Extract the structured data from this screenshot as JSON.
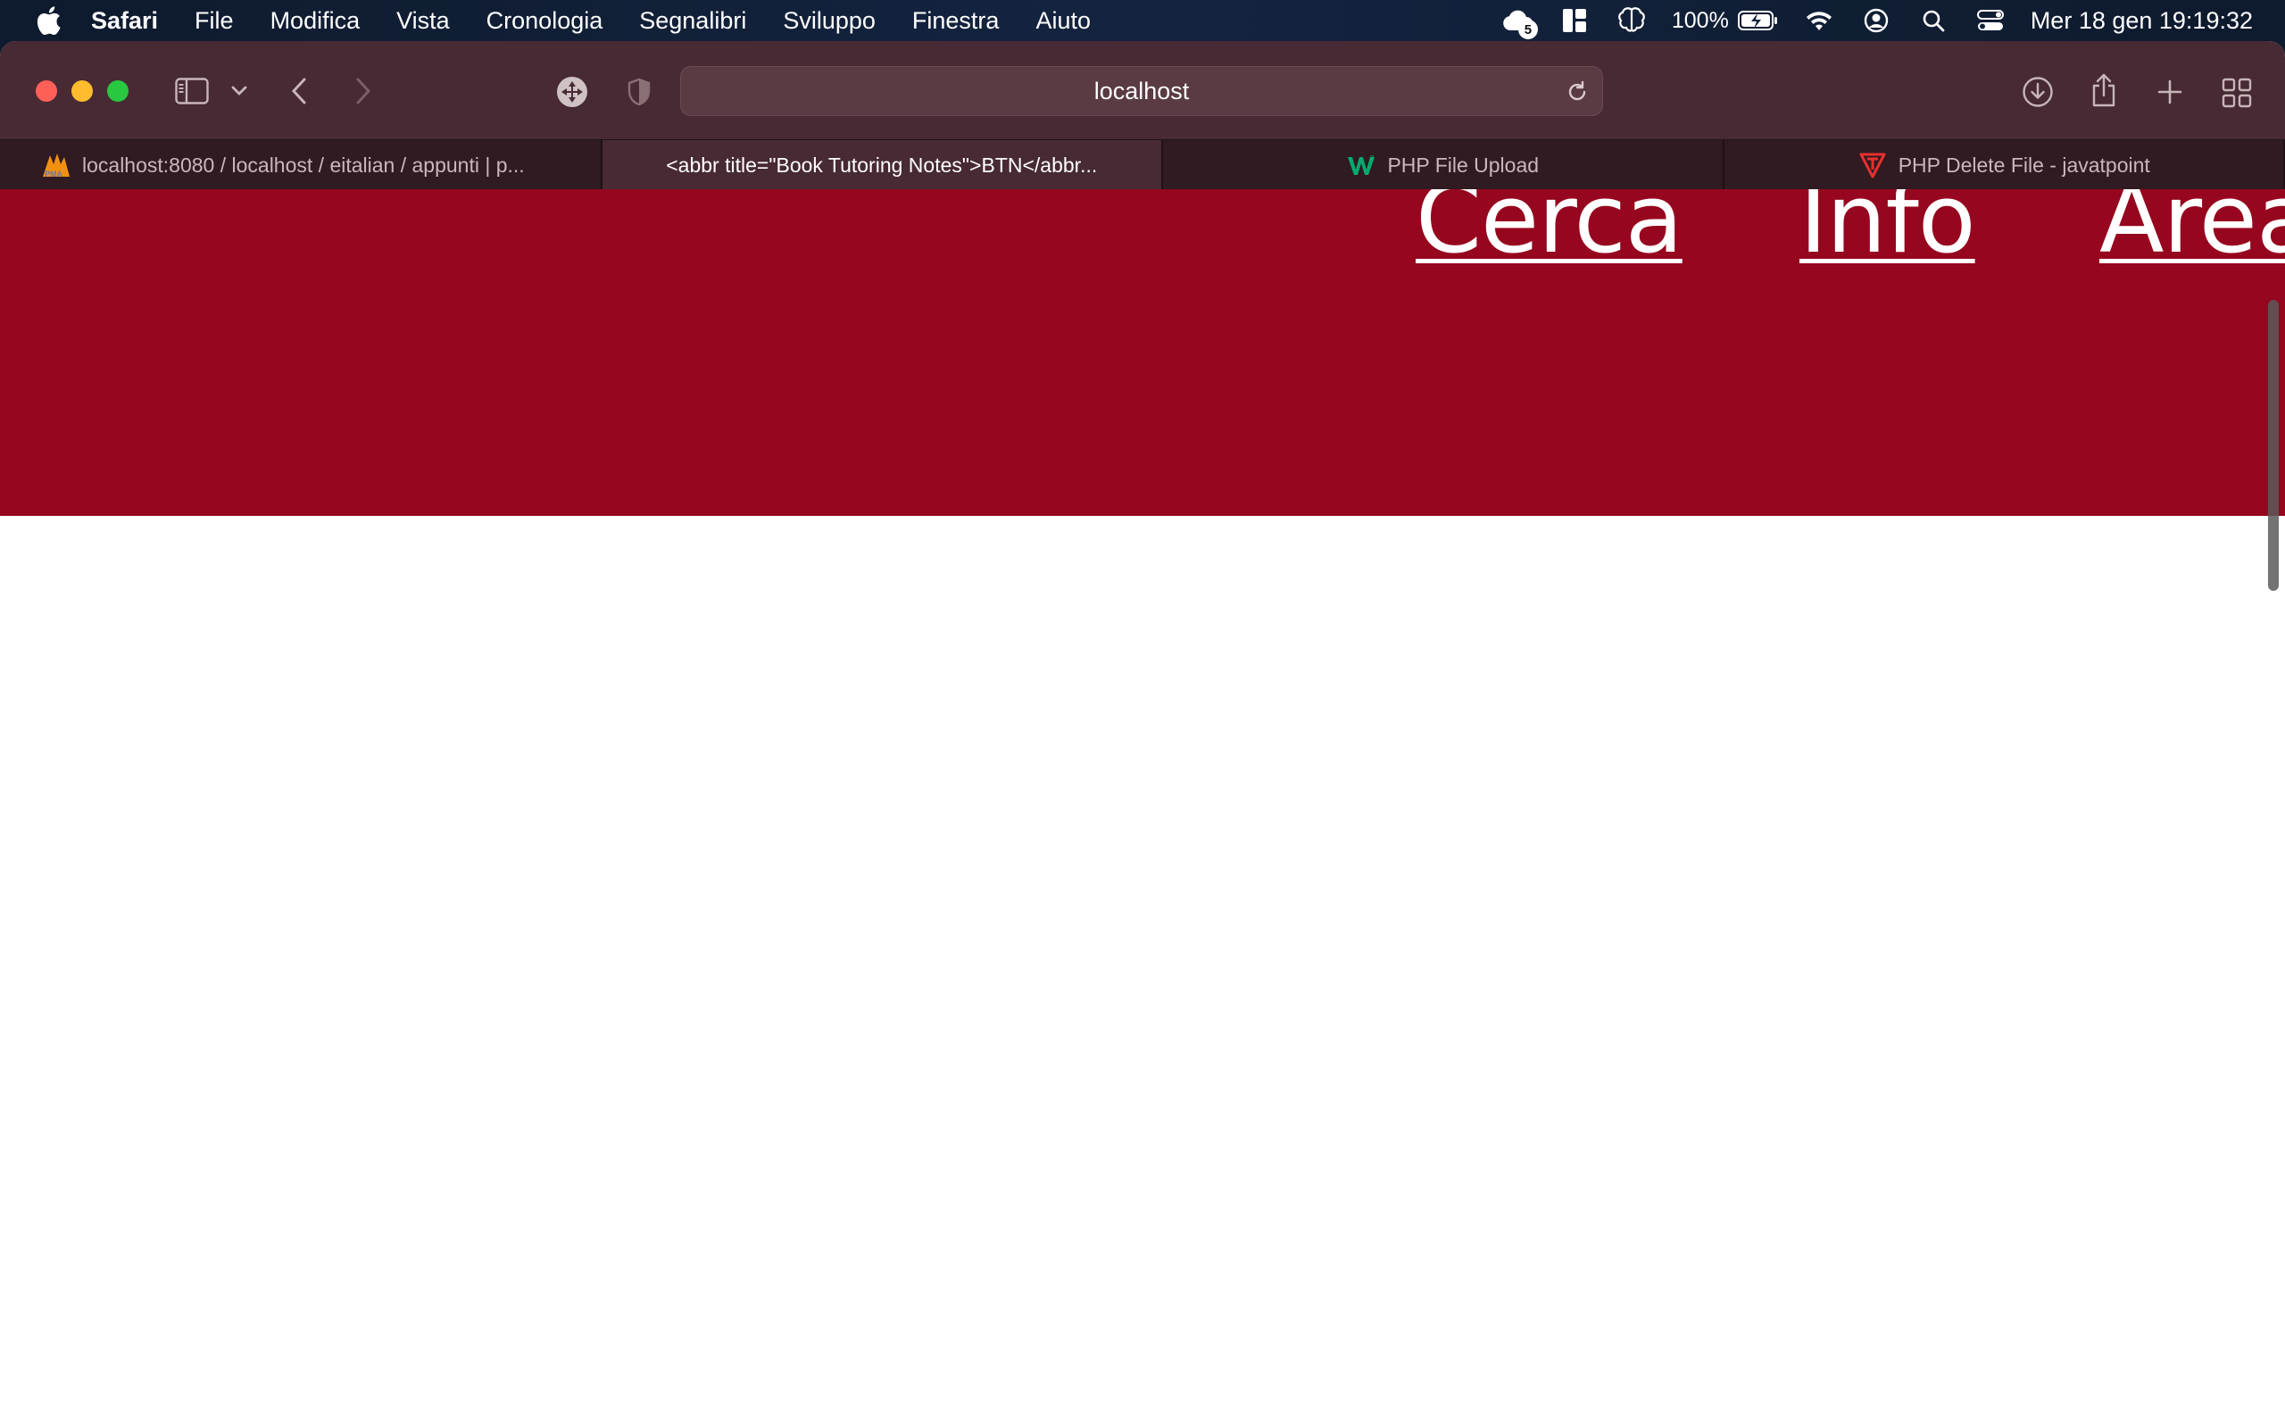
{
  "menubar": {
    "apple_icon": "apple-logo-icon",
    "items": [
      "Safari",
      "File",
      "Modifica",
      "Vista",
      "Cronologia",
      "Segnalibri",
      "Sviluppo",
      "Finestra",
      "Aiuto"
    ],
    "status": {
      "notification_count": "5",
      "battery": "100%",
      "clock": "Mer 18 gen  19:19:32"
    }
  },
  "browser": {
    "address": "localhost",
    "tabs": [
      {
        "label": "localhost:8080 / localhost / eitalian / appunti | p...",
        "favicon": "phpmyadmin-icon",
        "active": false
      },
      {
        "label": "<abbr title=\"Book Tutoring Notes\">BTN</abbr...",
        "favicon": "",
        "active": true
      },
      {
        "label": "PHP File Upload",
        "favicon": "w3schools-icon",
        "active": false
      },
      {
        "label": "PHP Delete File - javatpoint",
        "favicon": "javatpoint-icon",
        "active": false
      }
    ]
  },
  "page": {
    "nav": {
      "cerca": "Cerca",
      "info": "Info",
      "area": "Area"
    }
  },
  "colors": {
    "hero_background": "#96061e",
    "toolbar_background": "#472a33",
    "tabbar_background": "#2f1b21"
  }
}
